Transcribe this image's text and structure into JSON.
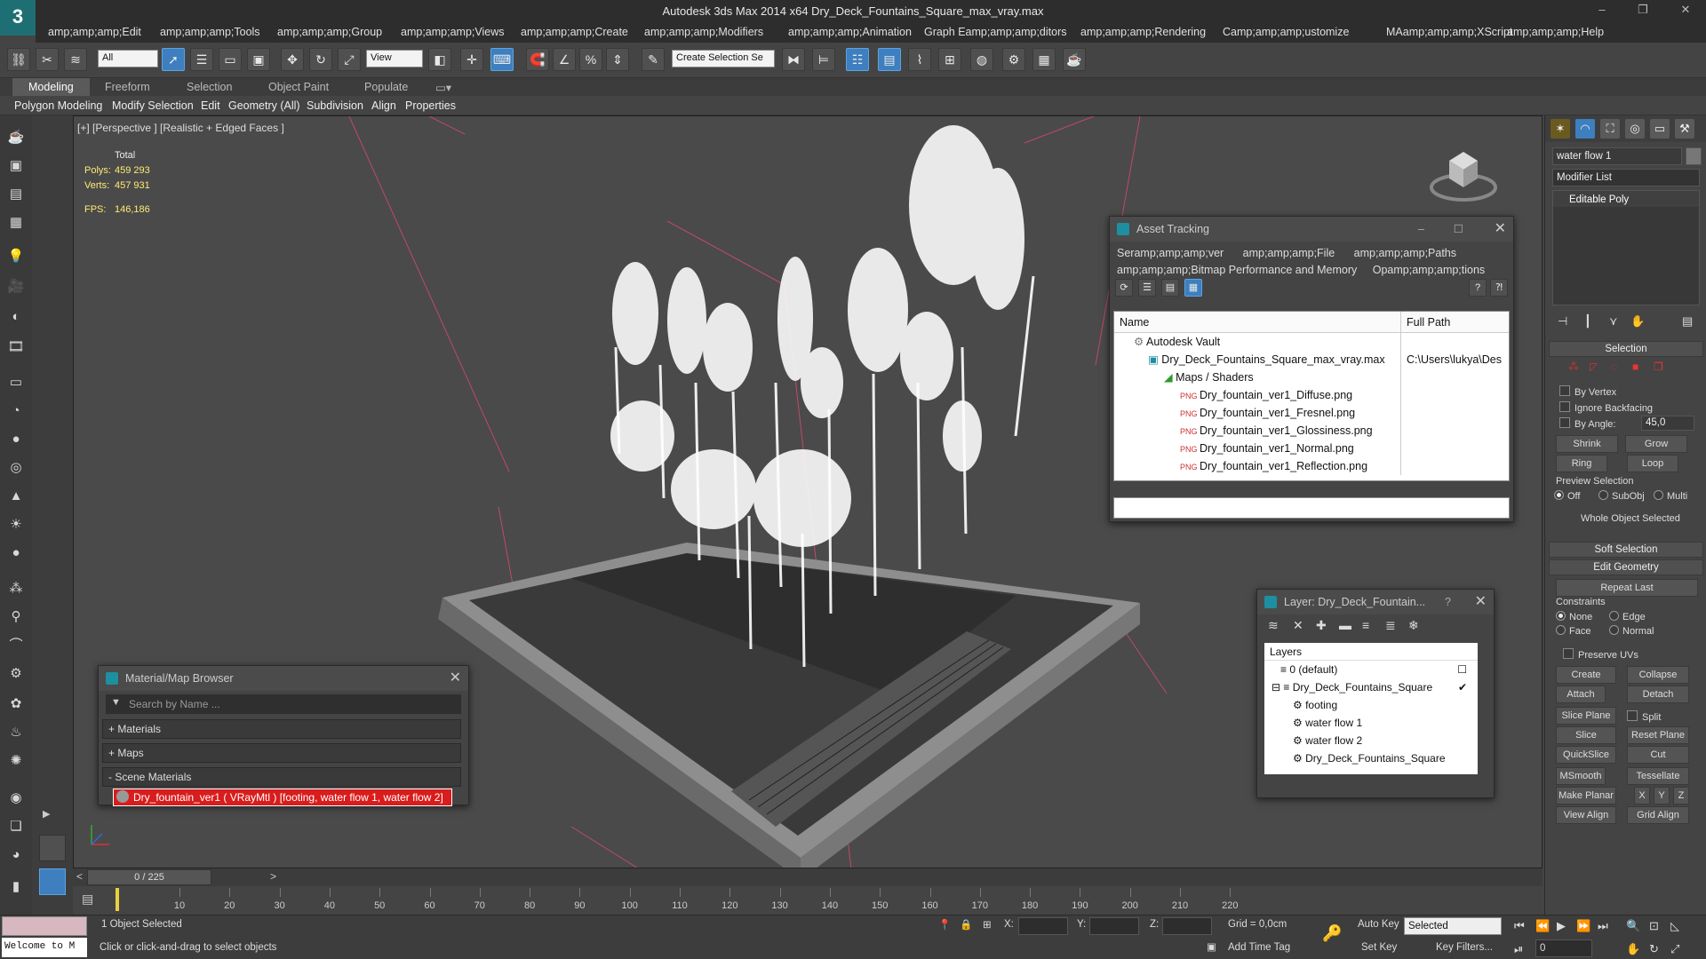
{
  "window": {
    "title": "Autodesk 3ds Max  2014 x64    Dry_Deck_Fountains_Square_max_vray.max",
    "logo_glyph": "3",
    "controls": [
      "–",
      "❐",
      "✕"
    ]
  },
  "menu": [
    "amp;amp;amp;Edit",
    "amp;amp;amp;Tools",
    "amp;amp;amp;Group",
    "amp;amp;amp;Views",
    "amp;amp;amp;Create",
    "amp;amp;amp;Modifiers",
    "amp;amp;amp;Animation",
    "Graph Eamp;amp;amp;ditors",
    "amp;amp;amp;Rendering",
    "Camp;amp;amp;ustomize",
    "MAamp;amp;amp;XScript",
    "amp;amp;amp;Help"
  ],
  "toolbar": {
    "filter_select": "All",
    "ref_coord_select": "View",
    "named_selection": "Create Selection Se"
  },
  "ribbon": {
    "tabs": [
      "Modeling",
      "Freeform",
      "Selection",
      "Object Paint",
      "Populate"
    ],
    "subtabs": [
      "Polygon Modeling",
      "Modify Selection",
      "Edit",
      "Geometry (All)",
      "Subdivision",
      "Align",
      "Properties"
    ]
  },
  "viewport": {
    "label": "[+] [Perspective ] [Realistic + Edged Faces ]",
    "stats": {
      "total_label": "Total",
      "polys_label": "Polys:",
      "polys": "459 293",
      "verts_label": "Verts:",
      "verts": "457 931",
      "fps_label": "FPS:",
      "fps": "146,186"
    }
  },
  "asset_tracking": {
    "title": "Asset Tracking",
    "menu_line1": [
      "Seramp;amp;amp;ver",
      "amp;amp;amp;File",
      "amp;amp;amp;Paths"
    ],
    "menu_line2": [
      "amp;amp;amp;Bitmap Performance and Memory",
      "Opamp;amp;amp;tions"
    ],
    "col_name": "Name",
    "col_path": "Full Path",
    "rows": [
      {
        "name": "Autodesk Vault",
        "path": ""
      },
      {
        "name": "Dry_Deck_Fountains_Square_max_vray.max",
        "path": "C:\\Users\\lukya\\Des"
      },
      {
        "name": "Maps / Shaders",
        "path": ""
      },
      {
        "name": "Dry_fountain_ver1_Diffuse.png",
        "path": ""
      },
      {
        "name": "Dry_fountain_ver1_Fresnel.png",
        "path": ""
      },
      {
        "name": "Dry_fountain_ver1_Glossiness.png",
        "path": ""
      },
      {
        "name": "Dry_fountain_ver1_Normal.png",
        "path": ""
      },
      {
        "name": "Dry_fountain_ver1_Reflection.png",
        "path": ""
      }
    ]
  },
  "layer_panel": {
    "title": "Layer: Dry_Deck_Fountain...",
    "help": "?",
    "header": "Layers",
    "items": [
      "0 (default)",
      "Dry_Deck_Fountains_Square",
      "footing",
      "water flow 1",
      "water flow 2",
      "Dry_Deck_Fountains_Square"
    ]
  },
  "material_browser": {
    "title": "Material/Map Browser",
    "search_placeholder": "Search by Name ...",
    "groups": [
      "+ Materials",
      "+ Maps",
      "- Scene Materials"
    ],
    "item": "Dry_fountain_ver1  ( VRayMtl )  [footing, water flow 1, water flow 2]"
  },
  "command_panel": {
    "object_name": "water flow 1",
    "modifier_list": "Modifier List",
    "stack_item": "Editable Poly",
    "selection_rollout": "Selection",
    "by_vertex": "By Vertex",
    "ignore_backfacing": "Ignore Backfacing",
    "by_angle": "By Angle:",
    "angle_value": "45,0",
    "shrink": "Shrink",
    "grow": "Grow",
    "ring": "Ring",
    "loop": "Loop",
    "preview_selection": "Preview Selection",
    "preview_off": "Off",
    "preview_subobj": "SubObj",
    "preview_multi": "Multi",
    "whole_object": "Whole Object Selected",
    "soft_selection": "Soft Selection",
    "edit_geometry": "Edit Geometry",
    "repeat_last": "Repeat Last",
    "constraints": "Constraints",
    "c_none": "None",
    "c_edge": "Edge",
    "c_face": "Face",
    "c_normal": "Normal",
    "preserve_uvs": "Preserve UVs",
    "create": "Create",
    "collapse": "Collapse",
    "attach": "Attach",
    "detach": "Detach",
    "slice_plane": "Slice Plane",
    "split": "Split",
    "slice": "Slice",
    "reset_plane": "Reset Plane",
    "quickslice": "QuickSlice",
    "cut": "Cut",
    "msmooth": "MSmooth",
    "tessellate": "Tessellate",
    "make_planar": "Make Planar",
    "x": "X",
    "y": "Y",
    "z": "Z",
    "view_align": "View Align",
    "grid_align": "Grid Align"
  },
  "timeline": {
    "frame_counter": "0 / 225",
    "ticks": [
      "10",
      "20",
      "30",
      "40",
      "50",
      "60",
      "70",
      "80",
      "90",
      "100",
      "110",
      "120",
      "130",
      "140",
      "150",
      "160",
      "170",
      "180",
      "190",
      "200",
      "210",
      "220"
    ]
  },
  "status": {
    "welcome": "Welcome to M",
    "selected": "1 Object Selected",
    "prompt": "Click or click-and-drag to select objects",
    "x_label": "X:",
    "y_label": "Y:",
    "z_label": "Z:",
    "grid": "Grid = 0,0cm",
    "auto_key": "Auto Key",
    "selected_dropdown": "Selected",
    "set_key": "Set Key",
    "key_filters": "Key Filters...",
    "add_time_tag": "Add Time Tag",
    "current_frame": "0"
  }
}
